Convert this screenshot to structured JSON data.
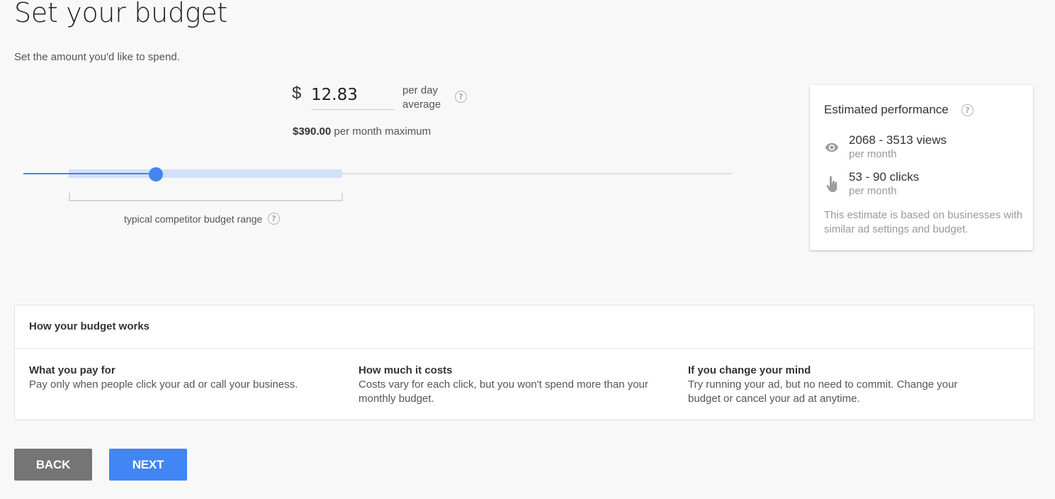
{
  "page": {
    "title": "Set your budget",
    "subtitle": "Set the amount you'd like to spend."
  },
  "budget": {
    "currency_symbol": "$",
    "daily_amount": "12.83",
    "per_day_label_line1": "per day",
    "per_day_label_line2": "average",
    "monthly_max_value": "$390.00",
    "monthly_max_label": " per month maximum"
  },
  "slider": {
    "range_label": "typical competitor budget range",
    "accent_color": "#4285f4"
  },
  "performance": {
    "title": "Estimated performance",
    "views_value": "2068 - 3513  views",
    "views_unit": "per month",
    "views_icon": "eye-icon",
    "clicks_value": "53 - 90  clicks",
    "clicks_unit": "per month",
    "clicks_icon": "pointer-hand-icon",
    "note": "This estimate is based on businesses with similar ad settings and budget."
  },
  "how_it_works": {
    "title": "How your budget works",
    "columns": [
      {
        "title": "What you pay for",
        "body": "Pay only when people click your ad or call your business."
      },
      {
        "title": "How much it costs",
        "body": "Costs vary for each click, but you won't spend more than your monthly budget."
      },
      {
        "title": "If you change your mind",
        "body": "Try running your ad, but no need to commit. Change your budget or cancel your ad at anytime."
      }
    ]
  },
  "buttons": {
    "back": "BACK",
    "next": "NEXT"
  }
}
